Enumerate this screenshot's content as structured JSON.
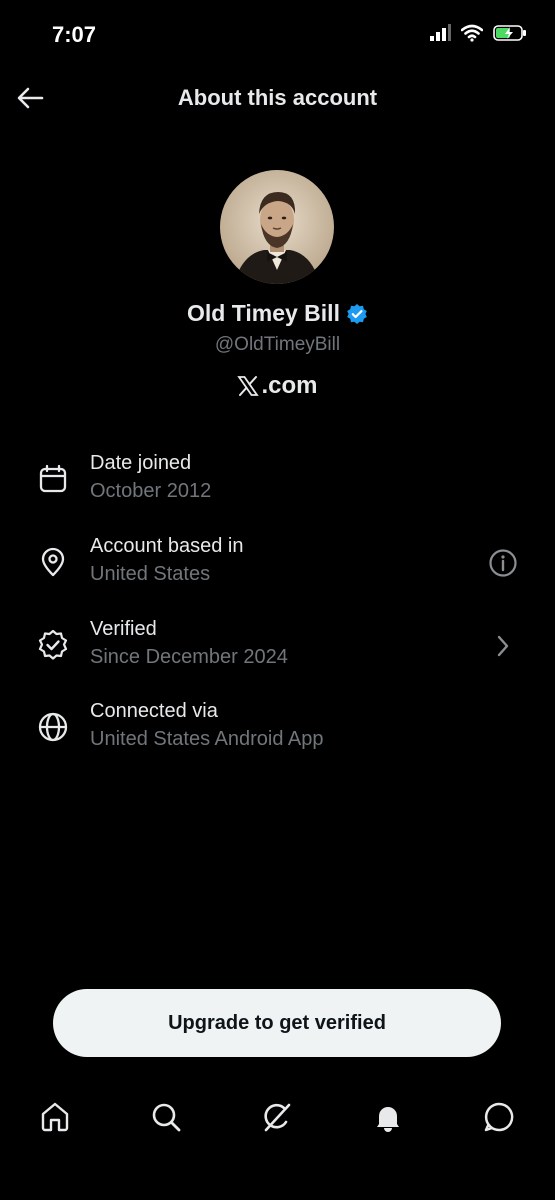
{
  "status_bar": {
    "time": "7:07"
  },
  "header": {
    "title": "About this account",
    "back_icon": "arrow-left-icon"
  },
  "profile": {
    "display_name": "Old Timey Bill",
    "handle": "@OldTimeyBill",
    "site_label": ".com",
    "site_logo": "X"
  },
  "info": [
    {
      "icon": "calendar-icon",
      "label": "Date joined",
      "value": "October 2012"
    },
    {
      "icon": "location-pin-icon",
      "label": "Account based in",
      "value": "United States",
      "trailing": "info-icon"
    },
    {
      "icon": "verified-badge-icon",
      "label": "Verified",
      "value": "Since December 2024",
      "trailing": "chevron-right-icon"
    },
    {
      "icon": "globe-icon",
      "label": "Connected via",
      "value": "United States Android App"
    }
  ],
  "upgrade": {
    "label": "Upgrade to get verified"
  },
  "nav": [
    "home-icon",
    "search-icon",
    "grok-icon",
    "notifications-bell-icon",
    "messages-icon"
  ],
  "colors": {
    "background": "#000000",
    "primary_text": "#e7e9ea",
    "secondary_text": "#71767b",
    "verified_blue": "#1d9bf0",
    "button_bg": "#eff3f4"
  }
}
